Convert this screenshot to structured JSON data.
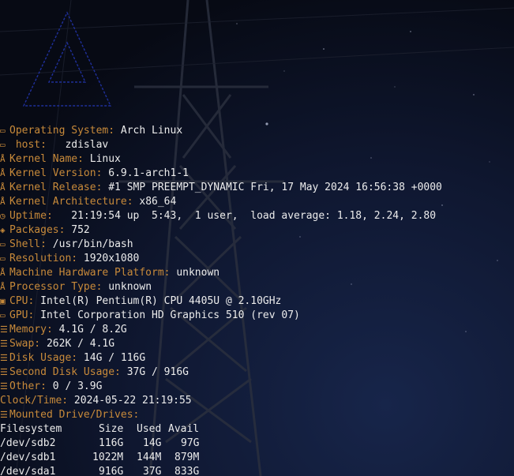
{
  "info": [
    {
      "icon": "monitor-icon",
      "glyph": "▭",
      "label": "Operating System:",
      "value": "Arch Linux"
    },
    {
      "icon": "monitor-icon",
      "glyph": "▭",
      "label": " host:",
      "value": "  zdislav"
    },
    {
      "icon": "tux-icon",
      "glyph": "Å",
      "label": "Kernel Name:",
      "value": "Linux"
    },
    {
      "icon": "tux-icon",
      "glyph": "Å",
      "label": "Kernel Version:",
      "value": "6.9.1-arch1-1"
    },
    {
      "icon": "tux-icon",
      "glyph": "Å",
      "label": "Kernel Release:",
      "value": "#1 SMP PREEMPT_DYNAMIC Fri, 17 May 2024 16:56:38 +0000"
    },
    {
      "icon": "tux-icon",
      "glyph": "Å",
      "label": "Kernel Architecture:",
      "value": "x86_64"
    },
    {
      "icon": "clock-icon",
      "glyph": "◷",
      "label": "Uptime:",
      "value": "  21:19:54 up  5:43,  1 user,  load average: 1.18, 2.24, 2.80"
    },
    {
      "icon": "package-icon",
      "glyph": "◈",
      "label": "Packages:",
      "value": "752"
    },
    {
      "icon": "terminal-icon",
      "glyph": "▭",
      "label": "Shell:",
      "value": "/usr/bin/bash"
    },
    {
      "icon": "monitor-icon",
      "glyph": "▭",
      "label": "Resolution:",
      "value": "1920x1080"
    },
    {
      "icon": "tux-icon",
      "glyph": "Å",
      "label": "Machine Hardware Platform:",
      "value": "unknown"
    },
    {
      "icon": "tux-icon",
      "glyph": "Å",
      "label": "Processor Type:",
      "value": "unknown"
    },
    {
      "icon": "cpu-icon",
      "glyph": "▣",
      "label": "CPU:",
      "value": "Intel(R) Pentium(R) CPU 4405U @ 2.10GHz"
    },
    {
      "icon": "gpu-icon",
      "glyph": "▭",
      "label": "GPU:",
      "value": "Intel Corporation HD Graphics 510 (rev 07)"
    },
    {
      "icon": "memory-icon",
      "glyph": "☰",
      "label": "Memory:",
      "value": "4.1G / 8.2G"
    },
    {
      "icon": "memory-icon",
      "glyph": "☰",
      "label": "Swap:",
      "value": "262K / 4.1G"
    },
    {
      "icon": "disk-icon",
      "glyph": "☰",
      "label": "Disk Usage:",
      "value": "14G / 116G"
    },
    {
      "icon": "disk-icon",
      "glyph": "☰",
      "label": "Second Disk Usage:",
      "value": "37G / 916G"
    },
    {
      "icon": "disk-icon",
      "glyph": "☰",
      "label": "Other:",
      "value": "0 / 3.9G"
    },
    {
      "icon": "",
      "glyph": "",
      "label": "Clock/Time:",
      "value": "2024-05-22 21:19:55"
    },
    {
      "icon": "disk-icon",
      "glyph": "☰",
      "label": "Mounted Drive/Drives:",
      "value": ""
    }
  ],
  "df": {
    "headers": [
      "Filesystem",
      "Size",
      "Used",
      "Avail"
    ],
    "rows": [
      [
        "/dev/sdb2",
        "116G",
        "14G",
        "97G"
      ],
      [
        "/dev/sdb1",
        "1022M",
        "144M",
        "879M"
      ],
      [
        "/dev/sda1",
        "916G",
        "37G",
        "833G"
      ]
    ]
  },
  "colors": {
    "label": "#c88a3a",
    "value": "#ececec",
    "logo": "#1f2f9a",
    "background": "#0a0e1a"
  }
}
